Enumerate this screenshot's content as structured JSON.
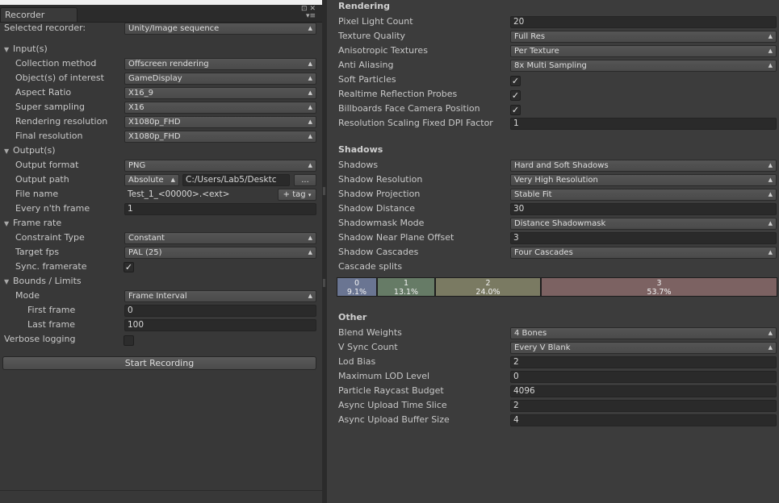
{
  "recorder": {
    "tab_title": "Recorder",
    "tab_icons": {
      "lock": "⊡",
      "close": "✕",
      "menu": "▾≡"
    },
    "selected_recorder": {
      "label": "Selected recorder:",
      "value": "Unity/Image sequence"
    },
    "inputs": {
      "header": "Input(s)",
      "collection_method": {
        "label": "Collection method",
        "value": "Offscreen rendering"
      },
      "objects_of_interest": {
        "label": "Object(s) of interest",
        "value": "GameDisplay"
      },
      "aspect_ratio": {
        "label": "Aspect Ratio",
        "value": "X16_9"
      },
      "super_sampling": {
        "label": "Super sampling",
        "value": "X16"
      },
      "rendering_resolution": {
        "label": "Rendering resolution",
        "value": "X1080p_FHD"
      },
      "final_resolution": {
        "label": "Final resolution",
        "value": "X1080p_FHD"
      }
    },
    "outputs": {
      "header": "Output(s)",
      "output_format": {
        "label": "Output format",
        "value": "PNG"
      },
      "output_path": {
        "label": "Output path",
        "mode": "Absolute",
        "path": "C:/Users/Lab5/Desktc",
        "browse": "..."
      },
      "file_name": {
        "label": "File name",
        "value": "Test_1_<00000>.<ext>",
        "tag_button": "+ tag"
      },
      "every_nth_frame": {
        "label": "Every n'th frame",
        "value": "1"
      }
    },
    "frame_rate": {
      "header": "Frame rate",
      "constraint_type": {
        "label": "Constraint Type",
        "value": "Constant"
      },
      "target_fps": {
        "label": "Target fps",
        "value": "PAL (25)"
      },
      "sync_framerate": {
        "label": "Sync. framerate",
        "checked": true
      }
    },
    "bounds": {
      "header": "Bounds / Limits",
      "mode": {
        "label": "Mode",
        "value": "Frame Interval"
      },
      "first_frame": {
        "label": "First frame",
        "value": "0"
      },
      "last_frame": {
        "label": "Last frame",
        "value": "100"
      }
    },
    "verbose_logging": {
      "label": "Verbose logging",
      "checked": false
    },
    "start_button": "Start Recording"
  },
  "quality": {
    "rendering": {
      "header": "Rendering",
      "pixel_light_count": {
        "label": "Pixel Light Count",
        "value": "20"
      },
      "texture_quality": {
        "label": "Texture Quality",
        "value": "Full Res"
      },
      "anisotropic_textures": {
        "label": "Anisotropic Textures",
        "value": "Per Texture"
      },
      "anti_aliasing": {
        "label": "Anti Aliasing",
        "value": "8x Multi Sampling"
      },
      "soft_particles": {
        "label": "Soft Particles",
        "checked": true
      },
      "realtime_reflection_probes": {
        "label": "Realtime Reflection Probes",
        "checked": true
      },
      "billboards_face_camera": {
        "label": "Billboards Face Camera Position",
        "checked": true
      },
      "resolution_scaling_dpi": {
        "label": "Resolution Scaling Fixed DPI Factor",
        "value": "1"
      }
    },
    "shadows": {
      "header": "Shadows",
      "shadows": {
        "label": "Shadows",
        "value": "Hard and Soft Shadows"
      },
      "shadow_resolution": {
        "label": "Shadow Resolution",
        "value": "Very High Resolution"
      },
      "shadow_projection": {
        "label": "Shadow Projection",
        "value": "Stable Fit"
      },
      "shadow_distance": {
        "label": "Shadow Distance",
        "value": "30"
      },
      "shadowmask_mode": {
        "label": "Shadowmask Mode",
        "value": "Distance Shadowmask"
      },
      "shadow_near_plane_offset": {
        "label": "Shadow Near Plane Offset",
        "value": "3"
      },
      "shadow_cascades": {
        "label": "Shadow Cascades",
        "value": "Four Cascades"
      },
      "cascade_splits": {
        "label": "Cascade splits",
        "splits": [
          {
            "index": "0",
            "percent": "9.1%",
            "fraction": 0.091,
            "color": "#6a7592"
          },
          {
            "index": "1",
            "percent": "13.1%",
            "fraction": 0.131,
            "color": "#667b66"
          },
          {
            "index": "2",
            "percent": "24.0%",
            "fraction": 0.24,
            "color": "#7a7a62"
          },
          {
            "index": "3",
            "percent": "53.7%",
            "fraction": 0.537,
            "color": "#7c6262"
          }
        ]
      }
    },
    "other": {
      "header": "Other",
      "blend_weights": {
        "label": "Blend Weights",
        "value": "4 Bones"
      },
      "v_sync_count": {
        "label": "V Sync Count",
        "value": "Every V Blank"
      },
      "lod_bias": {
        "label": "Lod Bias",
        "value": "2"
      },
      "maximum_lod_level": {
        "label": "Maximum LOD Level",
        "value": "0"
      },
      "particle_raycast_budget": {
        "label": "Particle Raycast Budget",
        "value": "4096"
      },
      "async_upload_time_slice": {
        "label": "Async Upload Time Slice",
        "value": "2"
      },
      "async_upload_buffer_size": {
        "label": "Async Upload Buffer Size",
        "value": "4"
      }
    }
  }
}
